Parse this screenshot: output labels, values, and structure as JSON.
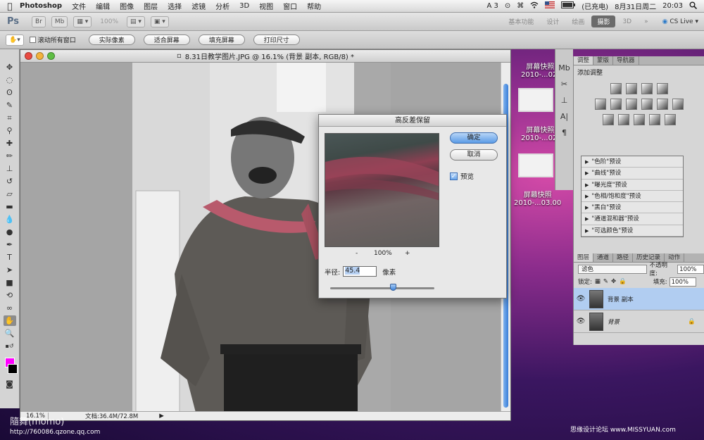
{
  "menubar": {
    "apple": "",
    "app_name": "Photoshop",
    "menus": [
      "文件",
      "编辑",
      "图像",
      "图层",
      "选择",
      "滤镜",
      "分析",
      "3D",
      "视图",
      "窗口",
      "帮助"
    ],
    "status_icons": [
      "A 3",
      "⊙",
      "⌘",
      "wifi",
      "🇺🇸"
    ],
    "charging": "(已充电)",
    "date": "8月31日周二",
    "time": "20:03"
  },
  "appbar": {
    "ps_logo": "Ps",
    "zoom": "100%",
    "workspaces": [
      "基本功能",
      "设计",
      "绘画",
      "摄影",
      "3D"
    ],
    "active_workspace": "摄影",
    "more": "»",
    "cs_live": "CS Live"
  },
  "optbar": {
    "scroll_all": "滚动所有窗口",
    "buttons": [
      "实际像素",
      "适合屏幕",
      "填充屏幕",
      "打印尺寸"
    ]
  },
  "document": {
    "title": "8.31日教学图片.JPG @ 16.1% (背景 副本, RGB/8) *",
    "zoom": "16.1%",
    "doc_size": "文档:36.4M/72.8M"
  },
  "dialog": {
    "title": "高反差保留",
    "ok": "确定",
    "cancel": "取消",
    "preview_label": "预览",
    "preview_checked": true,
    "zoom_minus": "-",
    "zoom_level": "100%",
    "zoom_plus": "+",
    "radius_label": "半径:",
    "radius_value": "45.4",
    "radius_unit": "像素",
    "radius_slider": 0.6
  },
  "desktop": {
    "items": [
      {
        "line1": "屏幕快照",
        "line2": "2010-...02."
      },
      {
        "line1": "屏幕快照",
        "line2": "2010-...02."
      },
      {
        "line1": "屏幕快照",
        "line2": "2010-...03.00"
      }
    ]
  },
  "adjustments": {
    "tabs": [
      "调整",
      "蒙版",
      "导航器"
    ],
    "title": "添加调整",
    "presets": [
      "\"色阶\"预设",
      "\"曲线\"预设",
      "\"曝光度\"预设",
      "\"色相/饱和度\"预设",
      "\"黑白\"预设",
      "\"通道混和器\"预设",
      "\"可选颜色\"预设"
    ]
  },
  "layers": {
    "tabs": [
      "图层",
      "通道",
      "路径",
      "历史记录",
      "动作"
    ],
    "blend_mode": "滤色",
    "opacity_label": "不透明度:",
    "opacity": "100%",
    "lock_label": "锁定:",
    "fill_label": "填充:",
    "fill": "100%",
    "items": [
      {
        "name": "背景 副本",
        "selected": true
      },
      {
        "name": "背景",
        "selected": false
      }
    ]
  },
  "watermarks": {
    "left": "隨舞(momo)",
    "left_url": "http://760086.qzone.qq.com",
    "right": "思缘设计论坛 www.MISSYUAN.com"
  },
  "colors": {
    "foreground": "#ff00ff",
    "background": "#000000",
    "accent": "#5a9be6"
  }
}
